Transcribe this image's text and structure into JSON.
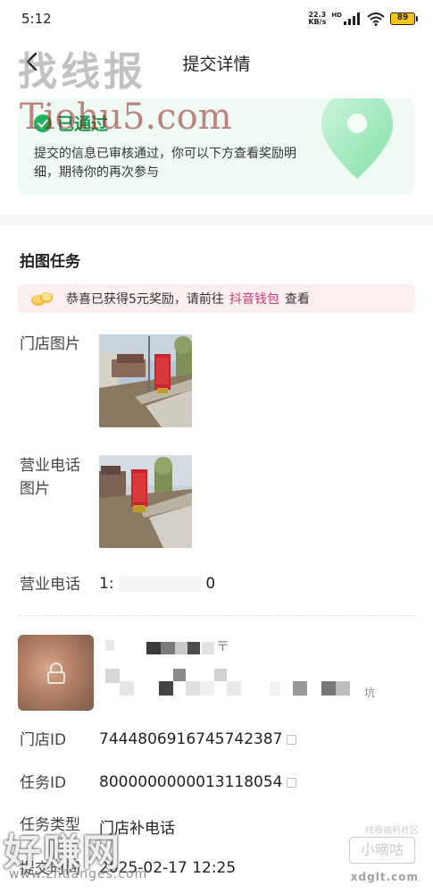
{
  "status_bar": {
    "time": "5:12",
    "net_speed_value": "22.3",
    "net_speed_unit": "KB/s",
    "hd": "HD",
    "battery": "89"
  },
  "nav": {
    "title": "提交详情"
  },
  "watermark": {
    "top_text": "找线报",
    "url_text": "Tiohu5.com",
    "bottom_text": "好赚网",
    "bottom_url": "www.zhuanges.com",
    "right_label": "小嘀咕",
    "right_url": "xdglt.com",
    "right_small": "线报福利社区"
  },
  "status_card": {
    "label": "已通过",
    "description": "提交的信息已审核通过，你可以下方查看奖励明细，期待你的再次参与"
  },
  "task": {
    "title": "拍图任务"
  },
  "reward": {
    "prefix": "恭喜已获得5元奖励，请前往",
    "link": "抖音钱包",
    "suffix": "查看"
  },
  "fields": {
    "store_photo_label": "门店图片",
    "phone_photo_label_line1": "营业电话",
    "phone_photo_label_line2": "图片",
    "phone_label": "营业电话",
    "phone_value_start": "1:",
    "phone_value_end": "0",
    "store_name_tail": "〒",
    "address_tail": "坑",
    "store_id_label": "门店ID",
    "store_id_value": "7444806916745742387",
    "task_id_label": "任务ID",
    "task_id_value": "8000000000013118054",
    "task_type_label": "任务类型",
    "task_type_value": "门店补电话",
    "submit_time_label": "提交时间",
    "submit_time_value": "2025-02-17 12:25"
  },
  "colors": {
    "accent_green": "#1a9a52",
    "reward_pink": "#d6336c",
    "card_bg": "#eefaf3"
  }
}
